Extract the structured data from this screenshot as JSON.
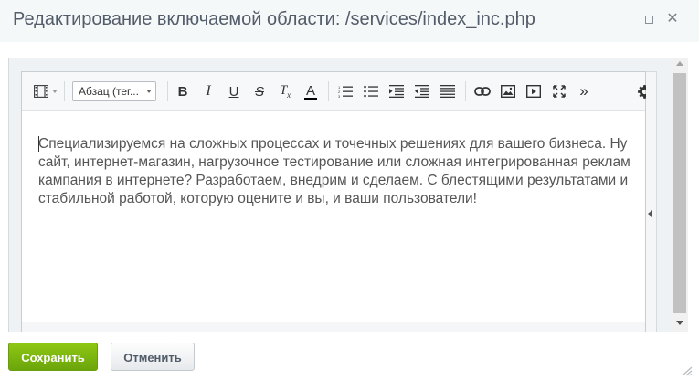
{
  "dialog": {
    "title": "Редактирование включаемой области: /services/index_inc.php"
  },
  "toolbar": {
    "mode_icon": "filmstrip-icon",
    "style_select_value": "Абзац (тег...",
    "buttons": [
      {
        "name": "bold",
        "glyph": "B"
      },
      {
        "name": "italic",
        "glyph": "I"
      },
      {
        "name": "underline",
        "glyph": "U"
      },
      {
        "name": "strikethrough",
        "glyph": "S"
      },
      {
        "name": "remove-format",
        "glyph": "T"
      },
      {
        "name": "font-color",
        "glyph": "A"
      },
      {
        "name": "ordered-list",
        "glyph": "ol-icon"
      },
      {
        "name": "unordered-list",
        "glyph": "ul-icon"
      },
      {
        "name": "outdent",
        "glyph": "outdent-icon"
      },
      {
        "name": "indent",
        "glyph": "indent-icon"
      },
      {
        "name": "justify",
        "glyph": "align-icon"
      },
      {
        "name": "link",
        "glyph": "link-icon"
      },
      {
        "name": "image",
        "glyph": "image-icon"
      },
      {
        "name": "video",
        "glyph": "video-icon"
      },
      {
        "name": "fullscreen",
        "glyph": "fullscreen-icon"
      },
      {
        "name": "more",
        "glyph": "»"
      },
      {
        "name": "settings",
        "glyph": "gear-icon"
      }
    ],
    "font_color": "#000000"
  },
  "editor": {
    "content": "Специализируемся на сложных процессах и точечных решениях для вашего бизнеса. Ну\nсайт, интернет-магазин, нагрузочное тестирование или сложная интегрированная реклам\nкампания в интернете? Разработаем, внедрим и сделаем. С блестящими результатами и\nстабильной работой, которую оцените и вы, и ваши пользователи!"
  },
  "footer": {
    "save_label": "Сохранить",
    "cancel_label": "Отменить"
  },
  "colors": {
    "save_button": "#7ab50f",
    "title_text": "#535c69",
    "content_text": "#555555"
  }
}
